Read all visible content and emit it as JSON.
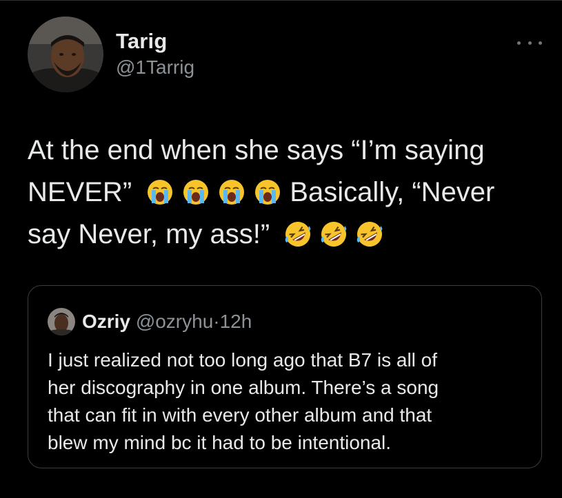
{
  "tweet": {
    "author": {
      "name": "Tarig",
      "handle": "@1Tarrig"
    },
    "text_lines": [
      "At the end when she says “I’m saying",
      "NEVER”",
      "Basically, “Never",
      "say Never, my ass!”"
    ],
    "emojis": {
      "crying_count": 4,
      "laughing_count": 3,
      "crying_icon": "loudly-crying-face-emoji",
      "laughing_icon": "rolling-on-floor-laughing-emoji"
    }
  },
  "quote": {
    "name": "Ozriy",
    "handle": "@ozryhu",
    "separator": "·",
    "time": "12h",
    "text_lines": [
      "I just realized not too long ago that B7 is all of",
      "her discography in one album. There’s a song",
      "that can fit in with every other album and that",
      "blew my mind bc it had to be intentional."
    ]
  },
  "colors": {
    "background": "#000000",
    "primary_text": "#e7e9ea",
    "secondary_text": "#8b9298",
    "border": "#3a3d41",
    "emoji_yellow": "#f7c52b"
  }
}
